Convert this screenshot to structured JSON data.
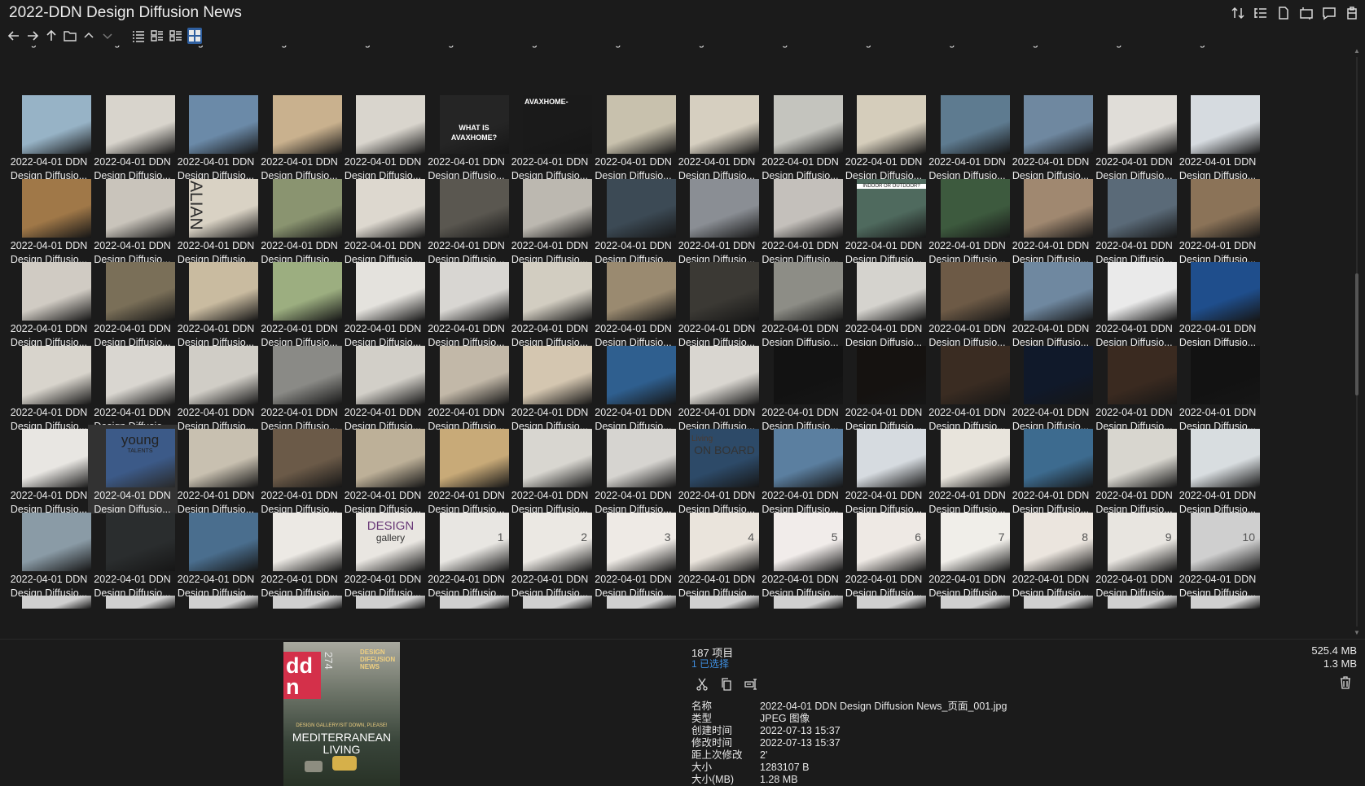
{
  "window": {
    "title": "2022-DDN Design Diffusion News",
    "view_tools": [
      "sort-icon",
      "details-list-icon",
      "file-icon",
      "preview-pane-icon",
      "tablet-icon",
      "clipboard-icon"
    ]
  },
  "nav": {
    "buttons": [
      "back-icon",
      "forward-icon",
      "up-icon",
      "folder-icon",
      "chevron-up-icon",
      "chevron-down-icon"
    ],
    "view_modes": [
      "list-view-icon",
      "details-view-icon",
      "tiles-view-icon",
      "thumbnails-view-icon"
    ],
    "active_view": "thumbnails-view-icon"
  },
  "thumbnails": {
    "caption_line1": "2022-04-01 DDN",
    "caption_line2": "Design Diffusio...",
    "selected_index": 76,
    "page_colors": [
      "#c8c3b6",
      "#b8a47c",
      "#d4d0c8",
      "#b9ad94",
      "#cfa66f",
      "#cfcac0",
      "#3a3a38",
      "#2d2a26",
      "#bfb6a0",
      "#ccc5b8",
      "#d8d6d0",
      "#3f5f82",
      "#bfb5a0",
      "#d8d6cf",
      "#3b4a58",
      "#97b3c6",
      "#d8d4cc",
      "#6b8aa8",
      "#c9b18e",
      "#d9d5cd",
      "#252525",
      "#1a1a1a",
      "#c8c1ad",
      "#d6cfc0",
      "#c4c4be",
      "#d5cdbb",
      "#5e7b90",
      "#6f88a0",
      "#e0ddd8",
      "#d6dbe0",
      "#a07848",
      "#c9c4bb",
      "#d9d2c4",
      "#8a9470",
      "#ddd8cf",
      "#5a5750",
      "#bcb8b0",
      "#3c4a55",
      "#8a8e94",
      "#c4c0bb",
      "#4f6a5e",
      "#3d5a3e",
      "#a08870",
      "#5a6a78",
      "#8b7358",
      "#d0cbc3",
      "#7a6f58",
      "#c9bba0",
      "#9cae80",
      "#e4e2dd",
      "#d8d6d2",
      "#d2cdc1",
      "#9a8a70",
      "#3b3934",
      "#8d8d86",
      "#d5d3ce",
      "#6d5a46",
      "#6f88a0",
      "#eaeaea",
      "#1f4e8c",
      "#d8d4cc",
      "#d9d6d0",
      "#d0cdc6",
      "#8a8a86",
      "#d2cfc8",
      "#c2b8a8",
      "#d4c6b0",
      "#2f5f8f",
      "#d9d6d0",
      "#121212",
      "#151210",
      "#3a2c22",
      "#10192a",
      "#3a2a20",
      "#121212",
      "#e8e6e2",
      "#3c5a88",
      "#c8c0b0",
      "#6b5a48",
      "#bdb098",
      "#c8aa78",
      "#d8d6d0",
      "#d6d4d0",
      "#2d4a68",
      "#5b7fa0",
      "#d6dbe0",
      "#e8e4dc",
      "#3d6b8f",
      "#d8d6cf",
      "#d8dde0",
      "#8a9ba6",
      "#2a2d2e",
      "#4a6e8e",
      "#ece9e4",
      "#e9e6e1",
      "#e8e6e2",
      "#ebe8e3",
      "#eeeae5",
      "#eae4dc",
      "#f1ecea",
      "#eee9e4",
      "#f0eee9",
      "#ebe5de",
      "#e8e5e0"
    ]
  },
  "overlays": {
    "whatis": "WHAT IS",
    "avaxhome_q": "AVAXHOME?",
    "avaxhome": "AVAXHOME-",
    "italian": "ALIAN",
    "indoor": "INDOOR OR OUTDOOR?",
    "young": "young",
    "talents": "TALENTS",
    "living": "Living",
    "onboard": "ON BOARD",
    "design": "DESIGN",
    "gallery": "gallery",
    "nums": [
      "1",
      "2",
      "3",
      "4",
      "5",
      "6",
      "7",
      "8",
      "9",
      "10"
    ]
  },
  "status": {
    "item_count": "187 项目",
    "selected_count": "1 已选择",
    "total_size": "525.4 MB",
    "selected_size": "1.3 MB"
  },
  "preview": {
    "logo": "dd n",
    "issue": "274",
    "masthead": "DESIGN DIFFUSION NEWS",
    "subline": "DESIGN GALLERY/SIT DOWN, PLEASE!",
    "headline": "MEDITERRANEAN LIVING"
  },
  "properties": [
    {
      "key": "名称",
      "value": "2022-04-01 DDN Design Diffusion News_页面_001.jpg"
    },
    {
      "key": "类型",
      "value": "JPEG 图像"
    },
    {
      "key": "创建时间",
      "value": "2022-07-13  15:37"
    },
    {
      "key": "修改时间",
      "value": "2022-07-13  15:37"
    },
    {
      "key": "距上次修改",
      "value": "2'"
    },
    {
      "key": "大小",
      "value": "1283107 B"
    },
    {
      "key": "大小(MB)",
      "value": "1.28 MB"
    }
  ],
  "colors": {
    "background": "#1b1b1b",
    "accent": "#3f8fe0",
    "selection": "#323232",
    "active_button": "#2f5f9f"
  }
}
